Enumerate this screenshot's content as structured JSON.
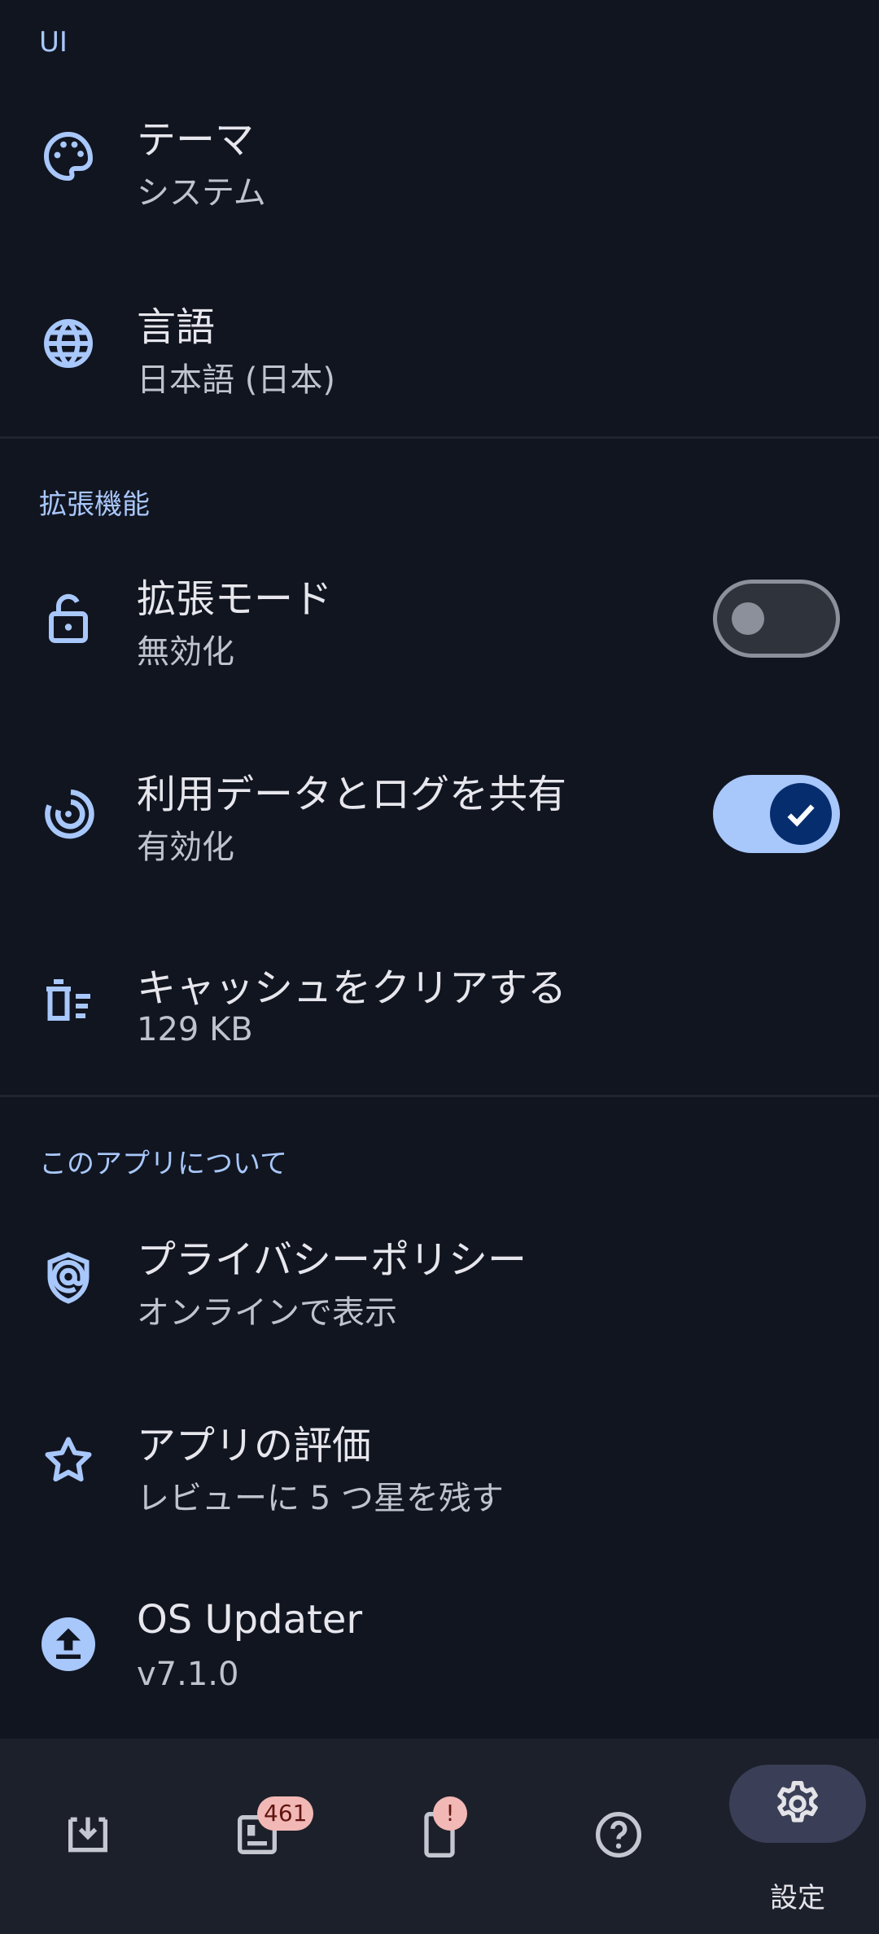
{
  "sections": {
    "ui": "UI",
    "extensions": "拡張機能",
    "about": "このアプリについて"
  },
  "items": {
    "theme": {
      "title": "テーマ",
      "subtitle": "システム",
      "icon": "palette-icon"
    },
    "language": {
      "title": "言語",
      "subtitle": "日本語 (日本)",
      "icon": "globe-icon"
    },
    "extended_mode": {
      "title": "拡張モード",
      "subtitle": "無効化",
      "icon": "lock-open-icon",
      "enabled": false
    },
    "share_usage": {
      "title": "利用データとログを共有",
      "subtitle": "有効化",
      "icon": "data-usage-icon",
      "enabled": true
    },
    "clear_cache": {
      "title": "キャッシュをクリアする",
      "subtitle": "129 KB",
      "icon": "delete-sweep-icon"
    },
    "privacy": {
      "title": "プライバシーポリシー",
      "subtitle": "オンラインで表示",
      "icon": "privacy-icon"
    },
    "rate_app": {
      "title": "アプリの評価",
      "subtitle": "レビューに 5 つ星を残す",
      "icon": "star-icon"
    },
    "os_updater": {
      "title": "OS Updater",
      "subtitle": "v7.1.0",
      "icon": "upload-icon"
    }
  },
  "nav": {
    "items": [
      {
        "icon": "download-icon"
      },
      {
        "icon": "news-icon",
        "badge": "461"
      },
      {
        "icon": "phone-icon",
        "badge": "!"
      },
      {
        "icon": "help-icon"
      },
      {
        "icon": "gear-icon",
        "label": "設定",
        "active": true
      }
    ]
  },
  "colors": {
    "background": "#111520",
    "accent": "#A8C7FA",
    "navbar": "#1C202B",
    "badge": "#F2B8B5"
  }
}
